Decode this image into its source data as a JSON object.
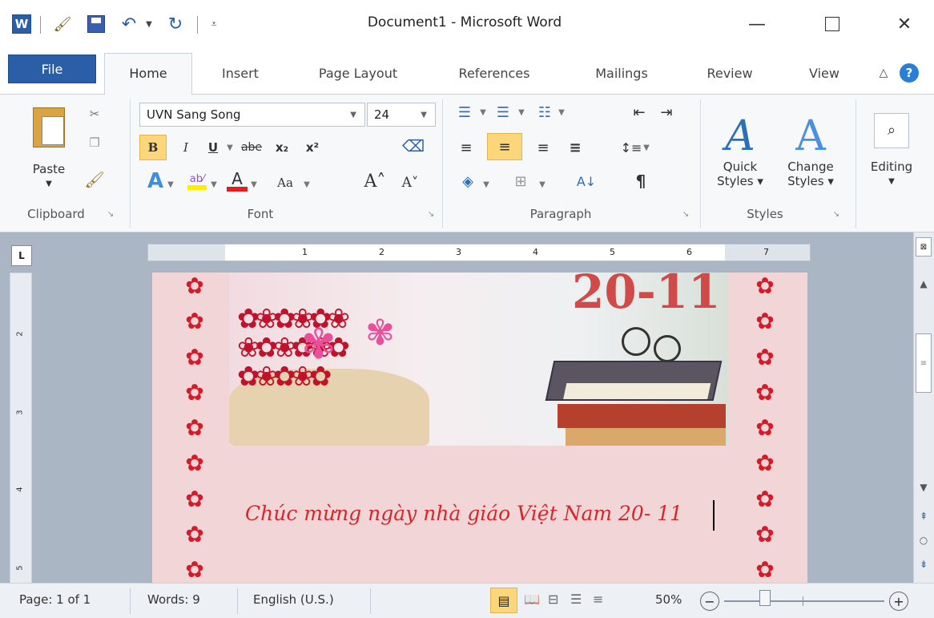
{
  "window": {
    "title": "Document1 - Microsoft Word"
  },
  "tabs": [
    "File",
    "Home",
    "Insert",
    "Page Layout",
    "References",
    "Mailings",
    "Review",
    "View"
  ],
  "clipboard": {
    "paste_label": "Paste",
    "group_label": "Clipboard"
  },
  "font": {
    "name": "UVN Sang Song",
    "size": "24",
    "group_label": "Font",
    "bold": "B",
    "italic": "I",
    "underline": "U",
    "strike": "abe",
    "sub": "x₂",
    "sup": "x²",
    "aa": "Aa"
  },
  "paragraph": {
    "group_label": "Paragraph",
    "pilcrow": "¶"
  },
  "styles": {
    "quick_line1": "Quick",
    "quick_line2": "Styles ▾",
    "change_line1": "Change",
    "change_line2": "Styles ▾",
    "group_label": "Styles"
  },
  "editing": {
    "label": "Editing"
  },
  "ruler": {
    "numbers": [
      "1",
      "2",
      "3",
      "4",
      "5",
      "6",
      "7"
    ],
    "vnumbers": [
      "2",
      "3",
      "4",
      "5"
    ]
  },
  "document": {
    "text": "Chúc mừng ngày nhà giáo Việt Nam 20- 11",
    "image_text": "20-11"
  },
  "status": {
    "page": "Page: 1 of 1",
    "words": "Words: 9",
    "language": "English (U.S.)",
    "zoom": "50%"
  },
  "colors": {
    "accent": "#2a5fa8",
    "highlight": "#fbd67a",
    "page": "#f2d5d6",
    "text_red": "#d6262b"
  }
}
